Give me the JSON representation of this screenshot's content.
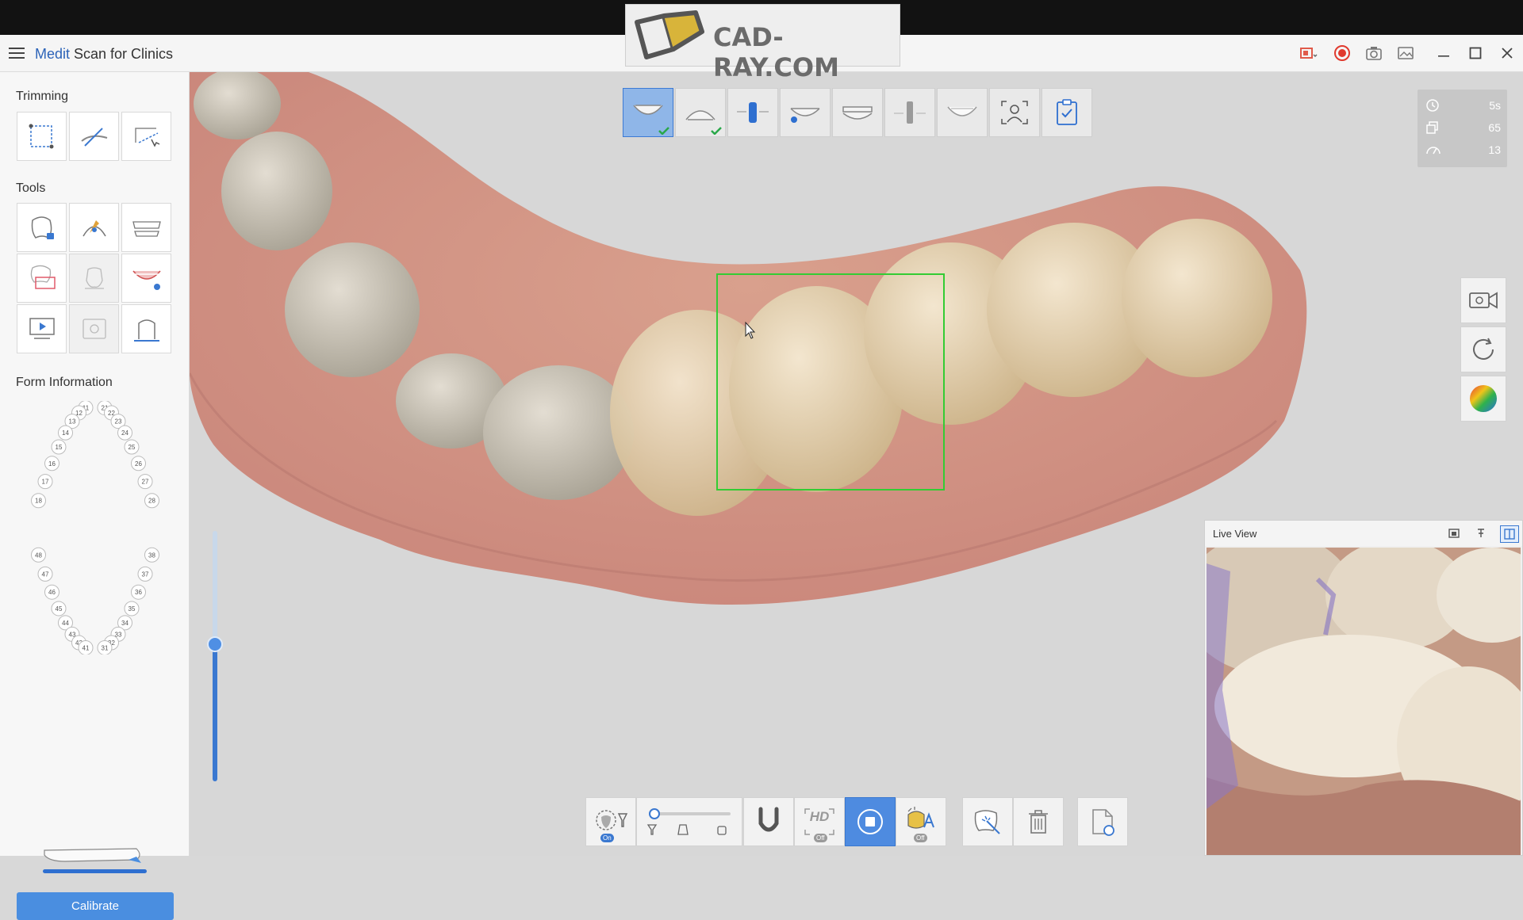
{
  "watermark": {
    "text": "CAD-RAY.COM"
  },
  "titlebar": {
    "brand": "Medit",
    "title": " Scan for Clinics"
  },
  "sidebar": {
    "trimming_title": "Trimming",
    "tools_title": "Tools",
    "form_title": "Form Information",
    "calibrate_label": "Calibrate",
    "tooth_numbers_upper": [
      "11",
      "21",
      "12",
      "22",
      "13",
      "23",
      "14",
      "24",
      "15",
      "25",
      "16",
      "26",
      "17",
      "27",
      "18",
      "28"
    ],
    "tooth_numbers_lower": [
      "48",
      "38",
      "47",
      "37",
      "46",
      "36",
      "45",
      "35",
      "44",
      "34",
      "43",
      "33",
      "42",
      "32",
      "41",
      "31"
    ]
  },
  "stats": {
    "time": "5s",
    "frames": "65",
    "rate": "13"
  },
  "live_view": {
    "title": "Live View"
  },
  "bottom_toolbar": {
    "filter_badge": "On",
    "hd_label": "HD",
    "hd_badge": "Off",
    "ai_badge": "Off"
  },
  "colors": {
    "accent": "#3a78d0",
    "active_stage": "#8fb6e8",
    "scan_box": "#33cc33",
    "record": "#e03a2e"
  }
}
